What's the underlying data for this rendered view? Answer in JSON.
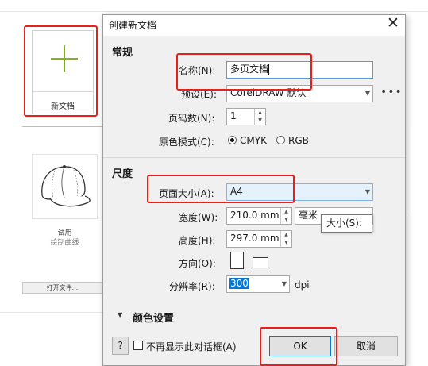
{
  "background": {
    "new_doc_label": "新文档",
    "trial_label": "试用",
    "trial_sub": "绘制曲线",
    "open_file_label": "打开文件..."
  },
  "dialog": {
    "title": "创建新文档",
    "general_section": "常规",
    "name_label": "名称(N):",
    "name_value": "多页文档",
    "preset_label": "预设(E):",
    "preset_value": "CorelDRAW 默认",
    "pages_label": "页码数(N):",
    "pages_value": "1",
    "color_mode_label": "原色模式(C):",
    "cmyk_label": "CMYK",
    "rgb_label": "RGB",
    "color_mode_selected": "CMYK",
    "size_section": "尺度",
    "page_size_label": "页面大小(A):",
    "page_size_value": "A4",
    "width_label": "宽度(W):",
    "width_value": "210.0 mm",
    "units_value": "毫米",
    "height_label": "高度(H):",
    "height_value": "297.0 mm",
    "orientation_label": "方向(O):",
    "resolution_label": "分辨率(R):",
    "resolution_value": "300",
    "resolution_unit": "dpi",
    "color_settings_label": "颜色设置",
    "help_label": "?",
    "dont_show_label": "不再显示此对话框(A)",
    "ok_label": "OK",
    "cancel_label": "取消",
    "tooltip_text": "大小(S):"
  },
  "colors": {
    "highlight": "#e8201c",
    "plus_accent": "#7ab51d",
    "input_focus": "#5b9bd5",
    "selection": "#0078d7"
  }
}
